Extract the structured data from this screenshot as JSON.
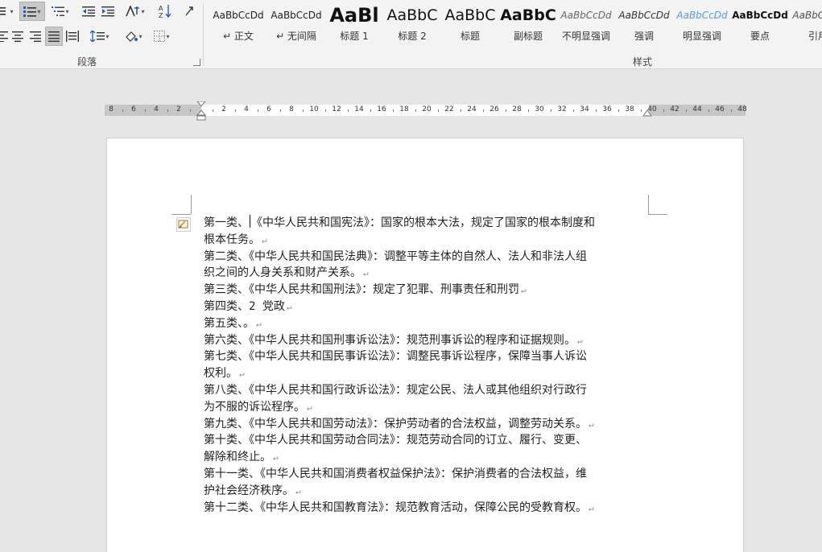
{
  "ribbon": {
    "paragraph_group_label": "段落",
    "styles_group_label": "样式",
    "styles": [
      {
        "sample": "AaBbCcDd",
        "name": "↵ 正文",
        "size": 12,
        "weight": "normal",
        "italic": false,
        "color": "#222222"
      },
      {
        "sample": "AaBbCcDd",
        "name": "↵ 无间隔",
        "size": 12,
        "weight": "normal",
        "italic": false,
        "color": "#222222"
      },
      {
        "sample": "AaBl",
        "name": "标题 1",
        "size": 24,
        "weight": "bold",
        "italic": false,
        "color": "#111111"
      },
      {
        "sample": "AaBbC",
        "name": "标题 2",
        "size": 19,
        "weight": "normal",
        "italic": false,
        "color": "#111111"
      },
      {
        "sample": "AaBbC",
        "name": "标题",
        "size": 19,
        "weight": "normal",
        "italic": false,
        "color": "#111111"
      },
      {
        "sample": "AaBbC",
        "name": "副标题",
        "size": 19,
        "weight": "bold",
        "italic": false,
        "color": "#111111"
      },
      {
        "sample": "AaBbCcDd",
        "name": "不明显强调",
        "size": 12,
        "weight": "normal",
        "italic": true,
        "color": "#666666"
      },
      {
        "sample": "AaBbCcDd",
        "name": "强调",
        "size": 12,
        "weight": "normal",
        "italic": true,
        "color": "#333333"
      },
      {
        "sample": "AaBbCcDd",
        "name": "明显强调",
        "size": 12,
        "weight": "normal",
        "italic": true,
        "color": "#5b9bd5"
      },
      {
        "sample": "AaBbCcDd",
        "name": "要点",
        "size": 12,
        "weight": "bold",
        "italic": false,
        "color": "#111111"
      },
      {
        "sample": "AaBbCcDd",
        "name": "引用",
        "size": 12,
        "weight": "normal",
        "italic": true,
        "color": "#555555"
      }
    ],
    "icons": [
      "bullets-icon",
      "numbering-icon",
      "multilevel-list-icon",
      "decrease-indent-icon",
      "increase-indent-icon",
      "chinese-layout-icon",
      "sort-icon",
      "show-marks-icon",
      "align-left-icon",
      "align-center-icon",
      "align-right-icon",
      "justify-icon",
      "distributed-icon",
      "line-spacing-icon",
      "shading-icon",
      "borders-icon"
    ]
  },
  "ruler": {
    "left_numbers": [
      "8",
      "6",
      "4",
      "2"
    ],
    "right_numbers": [
      "2",
      "4",
      "6",
      "8",
      "10",
      "12",
      "14",
      "16",
      "18",
      "20",
      "22",
      "24",
      "26",
      "28",
      "30",
      "32",
      "34",
      "36",
      "38",
      "40",
      "42",
      "44",
      "46",
      "48"
    ]
  },
  "document": {
    "lines": [
      {
        "text": "第一类、《中华人民共和国宪法》：国家的根本大法，规定了国家的根本制度和",
        "mark": false
      },
      {
        "text": "根本任务。",
        "mark": true
      },
      {
        "text": "第二类、《中华人民共和国民法典》：调整平等主体的自然人、法人和非法人组",
        "mark": false
      },
      {
        "text": "织之间的人身关系和财产关系。",
        "mark": true
      },
      {
        "text": "第三类、《中华人民共和国刑法》：规定了犯罪、刑事责任和刑罚",
        "mark": true
      },
      {
        "text": "第四类、2 党政",
        "mark": true
      },
      {
        "text": "第五类、。",
        "mark": true
      },
      {
        "text": "第六类、《中华人民共和国刑事诉讼法》：规范刑事诉讼的程序和证据规则。",
        "mark": true
      },
      {
        "text": "第七类、《中华人民共和国民事诉讼法》：调整民事诉讼程序，保障当事人诉讼",
        "mark": false
      },
      {
        "text": "权利。",
        "mark": true
      },
      {
        "text": "第八类、《中华人民共和国行政诉讼法》：规定公民、法人或其他组织对行政行",
        "mark": false
      },
      {
        "text": "为不服的诉讼程序。",
        "mark": true
      },
      {
        "text": "第九类、《中华人民共和国劳动法》：保护劳动者的合法权益，调整劳动关系。",
        "mark": true
      },
      {
        "text": "第十类、《中华人民共和国劳动合同法》：规范劳动合同的订立、履行、变更、",
        "mark": false
      },
      {
        "text": "解除和终止。",
        "mark": true
      },
      {
        "text": "第十一类、《中华人民共和国消费者权益保护法》：保护消费者的合法权益，维",
        "mark": false
      },
      {
        "text": "护社会经济秩序。",
        "mark": true
      },
      {
        "text": "第十二类、《中华人民共和国教育法》：规范教育活动，保障公民的受教育权。",
        "mark": true
      }
    ],
    "paragraph_mark": "↵",
    "cursor_after": "第一类、"
  }
}
